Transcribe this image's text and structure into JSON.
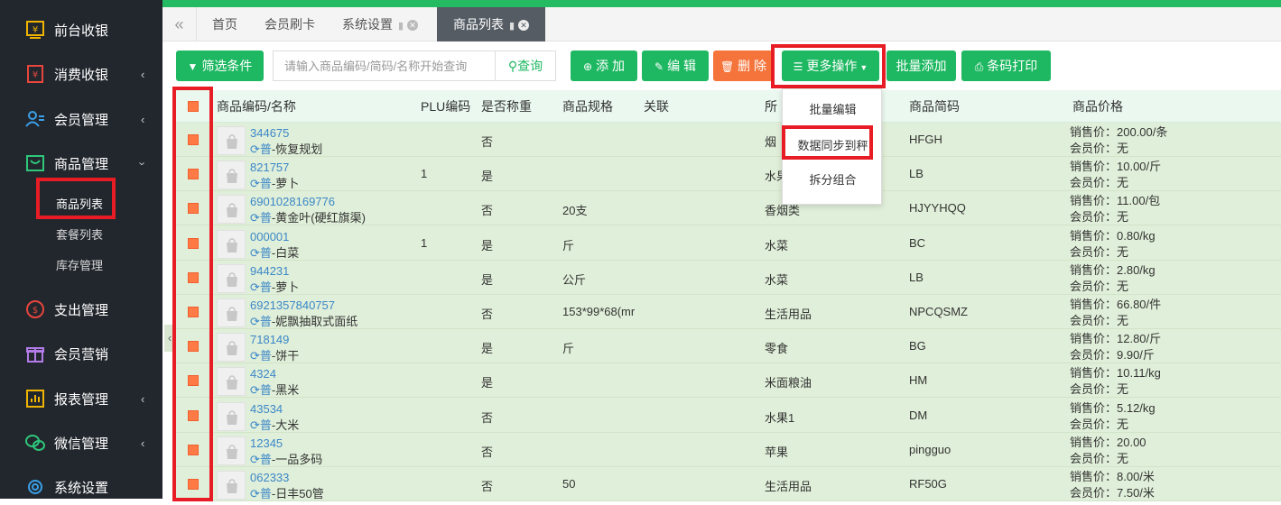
{
  "colors": {
    "accent": "#1fb862",
    "sidebar_bg": "#22272e",
    "highlight_box": "#e81c24",
    "delete_btn": "#f5743b",
    "row_bg": "#e0efd9"
  },
  "sidebar": {
    "items": [
      {
        "label": "前台收银",
        "icon": "cashier-icon",
        "arrow": ""
      },
      {
        "label": "消费收银",
        "icon": "receipt-icon",
        "arrow": "‹"
      },
      {
        "label": "会员管理",
        "icon": "member-icon",
        "arrow": "‹"
      },
      {
        "label": "商品管理",
        "icon": "product-icon",
        "arrow": "›"
      },
      {
        "label": "支出管理",
        "icon": "expense-icon",
        "arrow": ""
      },
      {
        "label": "会员营销",
        "icon": "gift-icon",
        "arrow": ""
      },
      {
        "label": "报表管理",
        "icon": "report-icon",
        "arrow": "‹"
      },
      {
        "label": "微信管理",
        "icon": "wechat-icon",
        "arrow": "‹"
      },
      {
        "label": "系统设置",
        "icon": "settings-icon",
        "arrow": ""
      }
    ],
    "subitems": [
      {
        "label": "商品列表"
      },
      {
        "label": "套餐列表"
      },
      {
        "label": "库存管理"
      }
    ]
  },
  "tabs": [
    {
      "label": "首页"
    },
    {
      "label": "会员刷卡"
    },
    {
      "label": "系统设置"
    },
    {
      "label": "商品列表"
    }
  ],
  "toolbar": {
    "filter": "筛选条件",
    "search_placeholder": "请输入商品编码/简码/名称开始查询",
    "query": "查询",
    "add": "添 加",
    "edit": "编 辑",
    "delete": "删 除",
    "more": "更多操作",
    "batch_add": "批量添加",
    "barcode_print": "条码打印"
  },
  "dropdown": {
    "items": [
      "批量编辑",
      "数据同步到秤",
      "拆分组合"
    ]
  },
  "table": {
    "headers": [
      "商品编码/名称",
      "PLU编码",
      "是否称重",
      "商品规格",
      "关联",
      "所",
      "商品简码",
      "商品价格"
    ],
    "unit_prefix": "普",
    "rows": [
      {
        "code": "344675",
        "name": "-恢复规划",
        "plu": "",
        "weigh": "否",
        "spec": "",
        "category": "烟",
        "short": "HFGH",
        "sale": "销售价：200.00/条",
        "member": "会员价：无"
      },
      {
        "code": "821757",
        "name": "-萝卜",
        "plu": "1",
        "weigh": "是",
        "spec": "",
        "category": "水果",
        "short": "LB",
        "sale": "销售价：10.00/斤",
        "member": "会员价：无"
      },
      {
        "code": "6901028169776",
        "name": "-黄金叶(硬红旗渠)",
        "plu": "",
        "weigh": "否",
        "spec": "20支",
        "category": "香烟类",
        "short": "HJYYHQQ",
        "sale": "销售价：11.00/包",
        "member": "会员价：无"
      },
      {
        "code": "000001",
        "name": "-白菜",
        "plu": "1",
        "weigh": "是",
        "spec": "斤",
        "category": "水菜",
        "short": "BC",
        "sale": "销售价：0.80/kg",
        "member": "会员价：无"
      },
      {
        "code": "944231",
        "name": "-萝卜",
        "plu": "",
        "weigh": "是",
        "spec": "公斤",
        "category": "水菜",
        "short": "LB",
        "sale": "销售价：2.80/kg",
        "member": "会员价：无"
      },
      {
        "code": "6921357840757",
        "name": "-妮飘抽取式面纸",
        "plu": "",
        "weigh": "否",
        "spec": "153*99*68(mr",
        "category": "生活用品",
        "short": "NPCQSMZ",
        "sale": "销售价：66.80/件",
        "member": "会员价：无"
      },
      {
        "code": "718149",
        "name": "-饼干",
        "plu": "",
        "weigh": "是",
        "spec": "斤",
        "category": "零食",
        "short": "BG",
        "sale": "销售价：12.80/斤",
        "member": "会员价：9.90/斤"
      },
      {
        "code": "4324",
        "name": "-黑米",
        "plu": "",
        "weigh": "是",
        "spec": "",
        "category": "米面粮油",
        "short": "HM",
        "sale": "销售价：10.11/kg",
        "member": "会员价：无"
      },
      {
        "code": "43534",
        "name": "-大米",
        "plu": "",
        "weigh": "否",
        "spec": "",
        "category": "水果1",
        "short": "DM",
        "sale": "销售价：5.12/kg",
        "member": "会员价：无"
      },
      {
        "code": "12345",
        "name": "-一品多码",
        "plu": "",
        "weigh": "否",
        "spec": "",
        "category": "苹果",
        "short": "pingguo",
        "sale": "销售价：20.00",
        "member": "会员价：无"
      },
      {
        "code": "062333",
        "name": "-日丰50管",
        "plu": "",
        "weigh": "否",
        "spec": "50",
        "category": "生活用品",
        "short": "RF50G",
        "sale": "销售价：8.00/米",
        "member": "会员价：7.50/米"
      }
    ]
  }
}
